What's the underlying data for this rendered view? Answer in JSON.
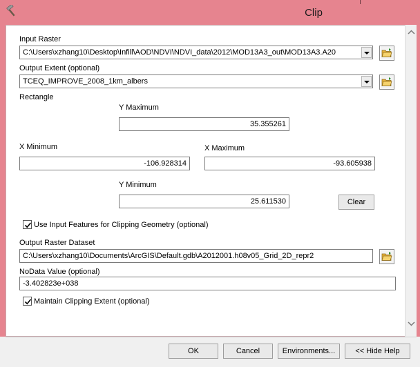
{
  "window": {
    "title": "Clip",
    "icon": "hammer-icon"
  },
  "form": {
    "input_raster": {
      "label": "Input Raster",
      "value": "C:\\Users\\xzhang10\\Desktop\\Infill\\AOD\\NDVI\\NDVI_data\\2012\\MOD13A3_out\\MOD13A3.A20"
    },
    "output_extent": {
      "label": "Output Extent (optional)",
      "value": "TCEQ_IMPROVE_2008_1km_albers"
    },
    "rectangle": {
      "label": "Rectangle",
      "y_max_label": "Y Maximum",
      "y_max": "35.355261",
      "x_min_label": "X Minimum",
      "x_min": "-106.928314",
      "x_max_label": "X Maximum",
      "x_max": "-93.605938",
      "y_min_label": "Y Minimum",
      "y_min": "25.611530",
      "clear_label": "Clear"
    },
    "use_input_features": {
      "label": "Use Input Features for Clipping Geometry (optional)",
      "checked": true
    },
    "output_raster": {
      "label": "Output Raster Dataset",
      "value": "C:\\Users\\xzhang10\\Documents\\ArcGIS\\Default.gdb\\A2012001.h08v05_Grid_2D_repr2"
    },
    "nodata": {
      "label": "NoData Value (optional)",
      "value": "-3.402823e+038"
    },
    "maintain_extent": {
      "label": "Maintain Clipping Extent (optional)",
      "checked": true
    }
  },
  "footer": {
    "ok": "OK",
    "cancel": "Cancel",
    "environments": "Environments...",
    "hide_help": "<< Hide Help"
  }
}
